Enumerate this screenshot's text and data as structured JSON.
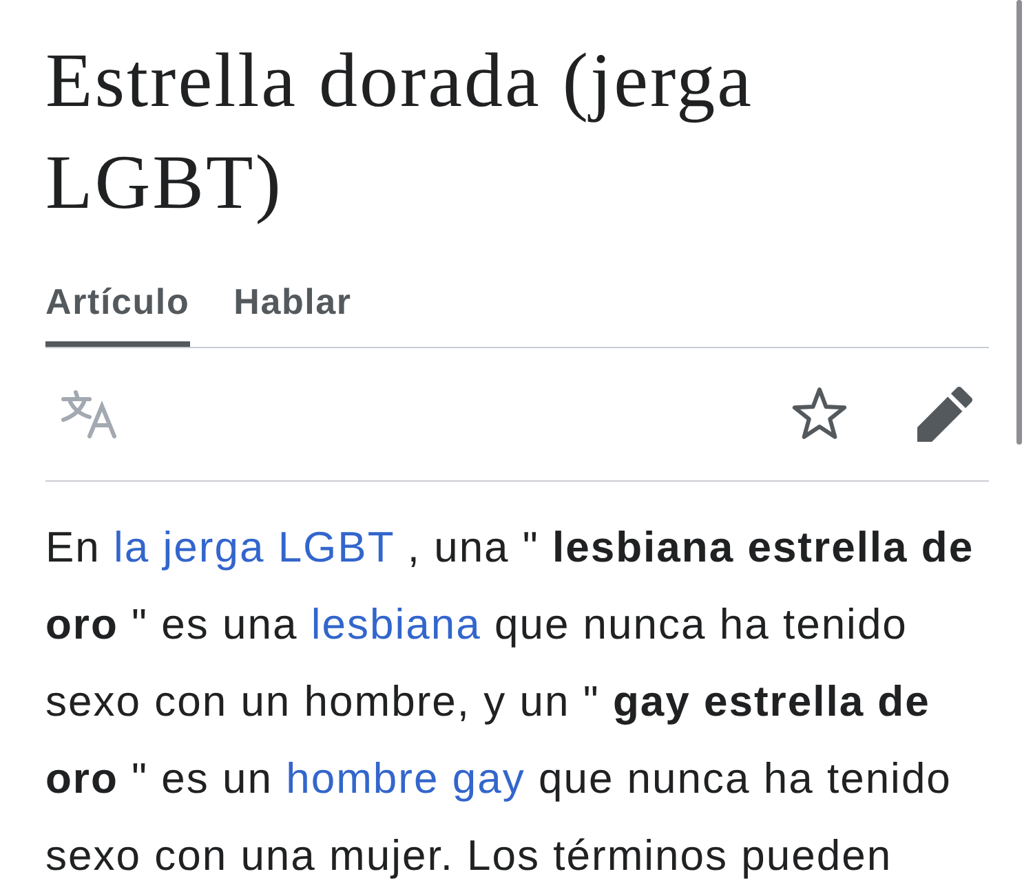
{
  "article": {
    "title": "Estrella dorada (jerga LGBT)"
  },
  "tabs": [
    {
      "label": "Artículo",
      "selected": true
    },
    {
      "label": "Hablar",
      "selected": false
    }
  ],
  "toolbar": {
    "starred": false
  },
  "paragraph": [
    {
      "kind": "text",
      "text": "En "
    },
    {
      "kind": "link",
      "text": "la jerga LGBT"
    },
    {
      "kind": "text",
      "text": " , una \" **lesbiana estrella de oro** \" es una "
    },
    {
      "kind": "link",
      "text": "lesbiana"
    },
    {
      "kind": "text",
      "text": " que nunca ha tenido sexo con un hombre, y un \" **gay estrella de oro** \" es un "
    },
    {
      "kind": "link",
      "text": "hombre gay"
    },
    {
      "kind": "text",
      "text": " que nunca ha tenido sexo con una mujer. Los términos pueden"
    }
  ]
}
